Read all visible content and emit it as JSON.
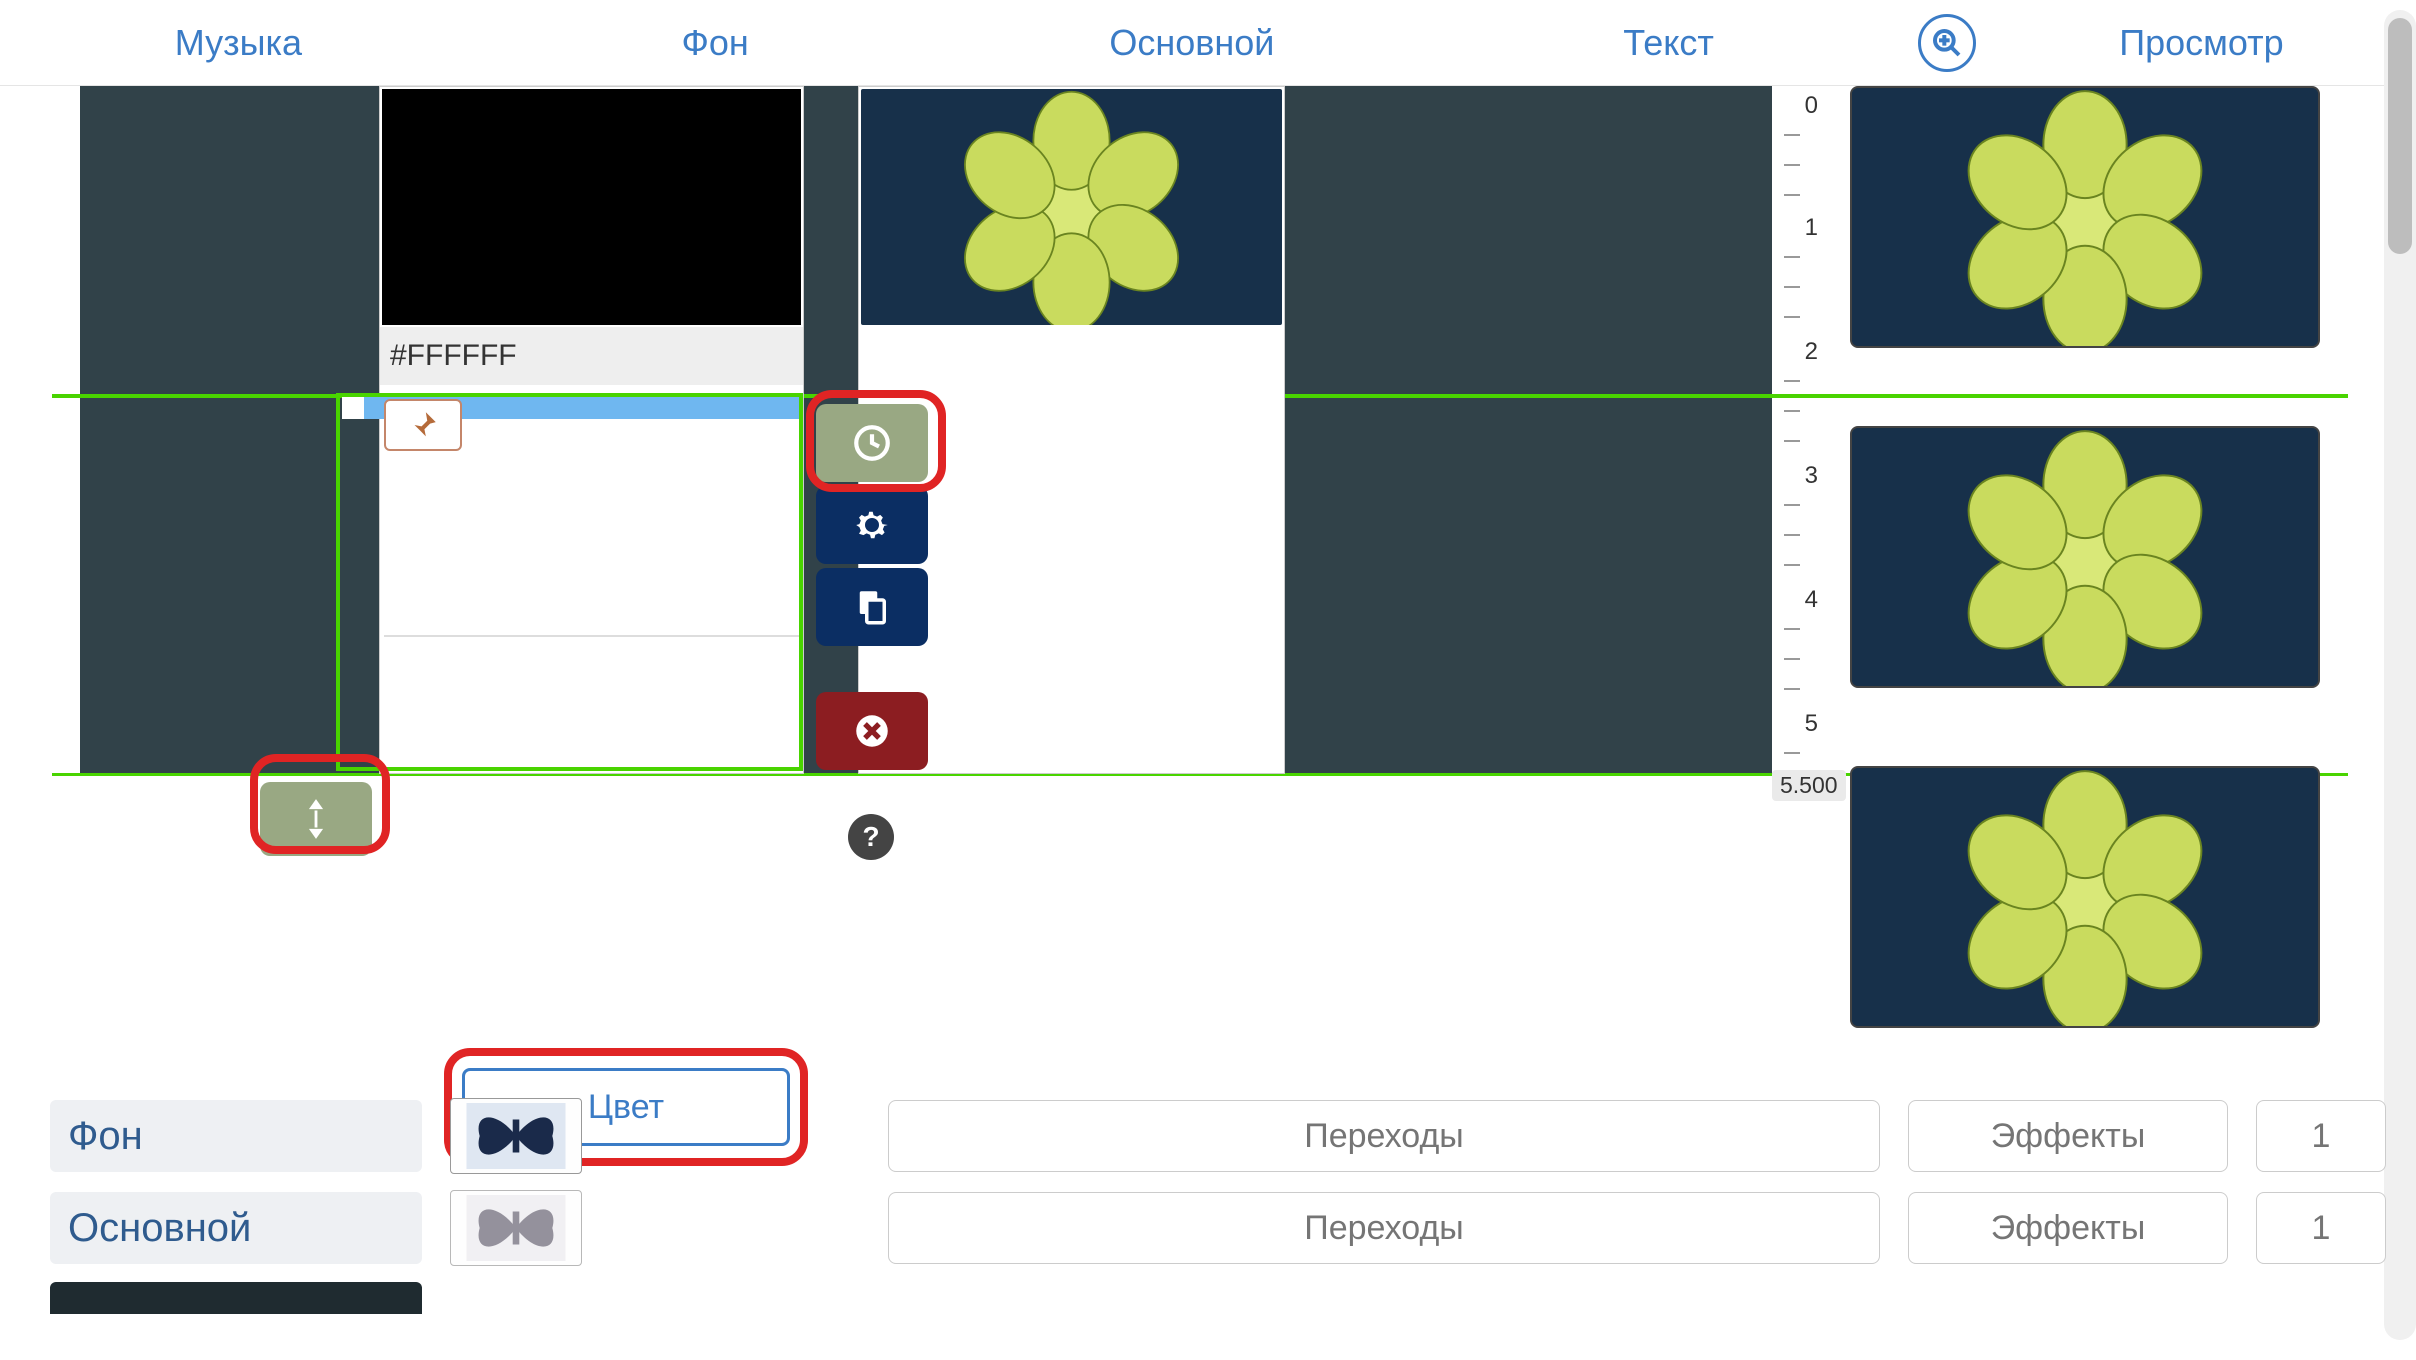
{
  "tabs": {
    "music": "Музыка",
    "background": "Фон",
    "main": "Основной",
    "text": "Текст",
    "preview": "Просмотр"
  },
  "ruler": {
    "t0": "0",
    "t1": "1",
    "t2": "2",
    "t3": "3",
    "t4": "4",
    "t5": "5",
    "end": "5.500"
  },
  "clip": {
    "hex": "#FFFFFF"
  },
  "buttons": {
    "color": "Цвет"
  },
  "layers": {
    "row1": {
      "label": "Фон",
      "transition": "Переходы",
      "effects": "Эффекты",
      "count": "1"
    },
    "row2": {
      "label": "Основной",
      "transition": "Переходы",
      "effects": "Эффекты",
      "count": "1"
    }
  },
  "icons": {
    "zoom": "zoom-in-icon",
    "pin": "pin-icon",
    "clock": "clock-icon",
    "gear": "gear-icon",
    "copy": "copy-icon",
    "delete": "delete-icon",
    "help": "help-icon",
    "stretch": "stretch-vertical-icon"
  }
}
